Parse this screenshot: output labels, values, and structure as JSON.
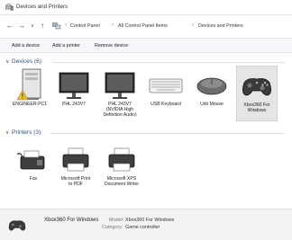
{
  "window": {
    "title": "Devices and Printers"
  },
  "nav": {
    "back": "←",
    "forward": "→",
    "recent": "∨",
    "up": "↑",
    "breadcrumb": [
      "Control Panel",
      "All Control Panel Items",
      "Devices and Printers"
    ],
    "separator": "›"
  },
  "toolbar": {
    "add_device": "Add a device",
    "add_printer": "Add a printer",
    "remove_device": "Remove device"
  },
  "devices": {
    "header": "Devices (6)",
    "items": [
      {
        "label": "ENGINEER-PC1",
        "icon": "computer-icon"
      },
      {
        "label": "PHL 243V7",
        "icon": "monitor-icon"
      },
      {
        "label": "PHL 243V7\n(NVIDIA High\nDefinition Audio)",
        "icon": "monitor-icon"
      },
      {
        "label": "USB Keyboard",
        "icon": "keyboard-icon"
      },
      {
        "label": "Usb Mouse",
        "icon": "mouse-icon"
      },
      {
        "label": "Xbox360 For\nWindows",
        "icon": "gamepad-icon",
        "selected": true
      }
    ]
  },
  "printers": {
    "header": "Printers (3)",
    "items": [
      {
        "label": "Fax",
        "icon": "fax-icon"
      },
      {
        "label": "Microsoft Print\nto PDF",
        "icon": "printer-icon"
      },
      {
        "label": "Microsoft XPS\nDocument Writer",
        "icon": "printer-icon"
      }
    ]
  },
  "details": {
    "name": "Xbox360 For Windows",
    "model_label": "Model:",
    "model_value": "Xbox360 For Windows",
    "category_label": "Category:",
    "category_value": "Game controller"
  },
  "colors": {
    "group_header": "#2b4f80",
    "selected_bg": "#e5e5e5",
    "warning": "#f0c020"
  }
}
